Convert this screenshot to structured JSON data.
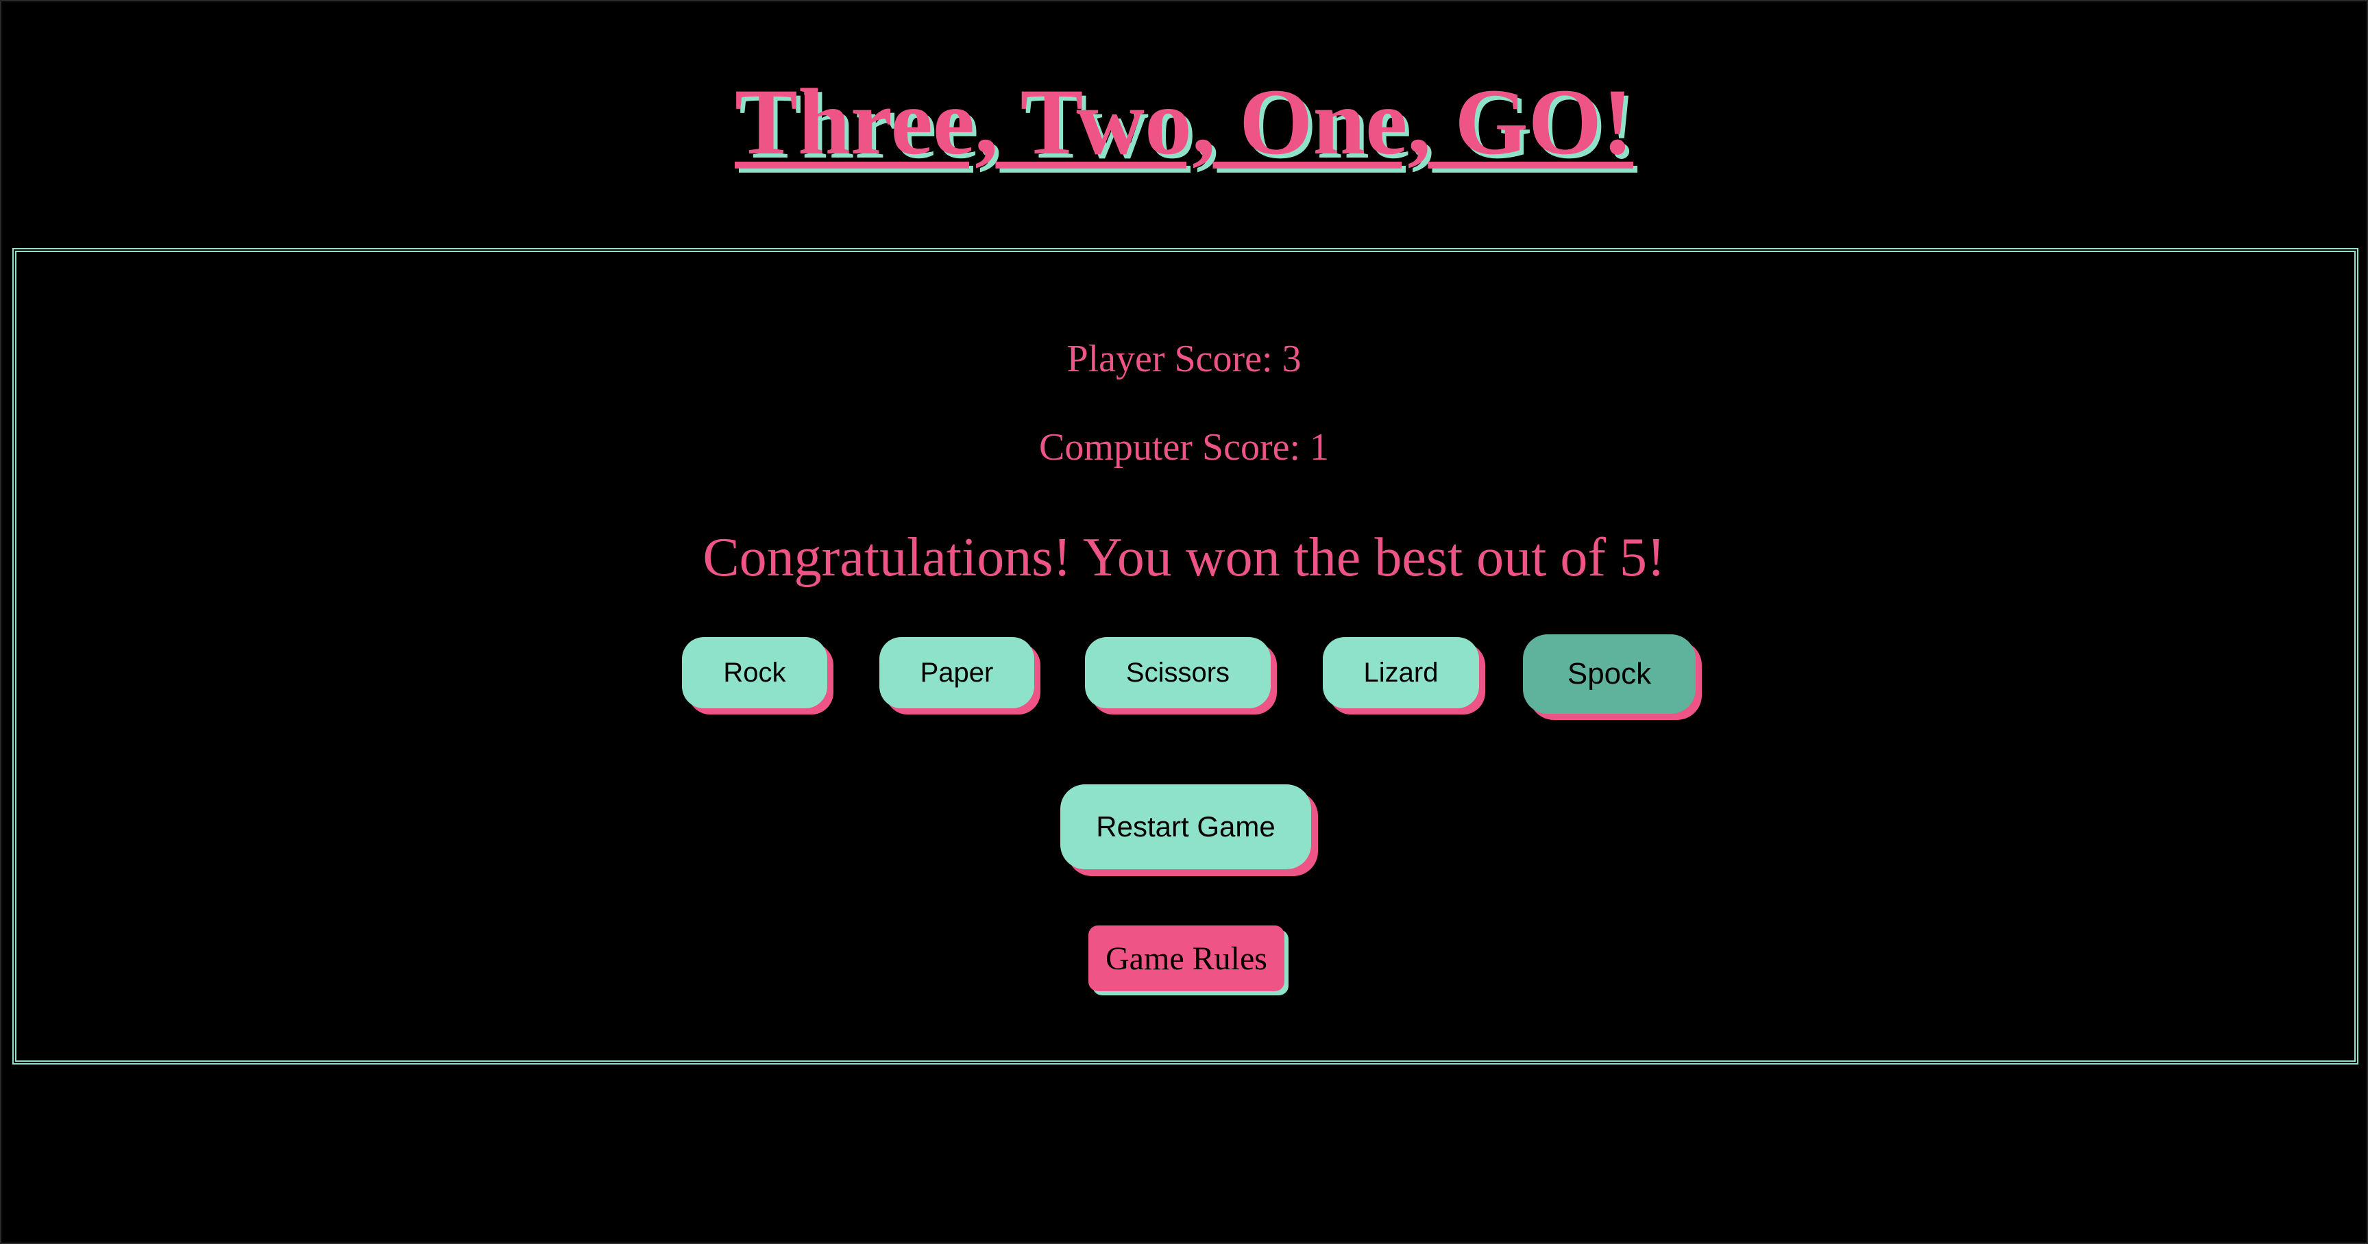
{
  "header": {
    "title": "Three, Two, One, GO!"
  },
  "scoreboard": {
    "player_label": "Player Score: 3",
    "computer_label": "Computer Score: 1",
    "player_score": 3,
    "computer_score": 1
  },
  "result": {
    "message": "Congratulations! You won the best out of 5!"
  },
  "choices": [
    {
      "label": "Rock",
      "active": false
    },
    {
      "label": "Paper",
      "active": false
    },
    {
      "label": "Scissors",
      "active": false
    },
    {
      "label": "Lizard",
      "active": false
    },
    {
      "label": "Spock",
      "active": true
    }
  ],
  "controls": {
    "restart_label": "Restart Game",
    "rules_label": "Game Rules"
  },
  "colors": {
    "background": "#000000",
    "accent_pink": "#ee5486",
    "accent_mint": "#8ee2c9",
    "active_mint": "#5fb39c",
    "button_text": "#000000"
  }
}
